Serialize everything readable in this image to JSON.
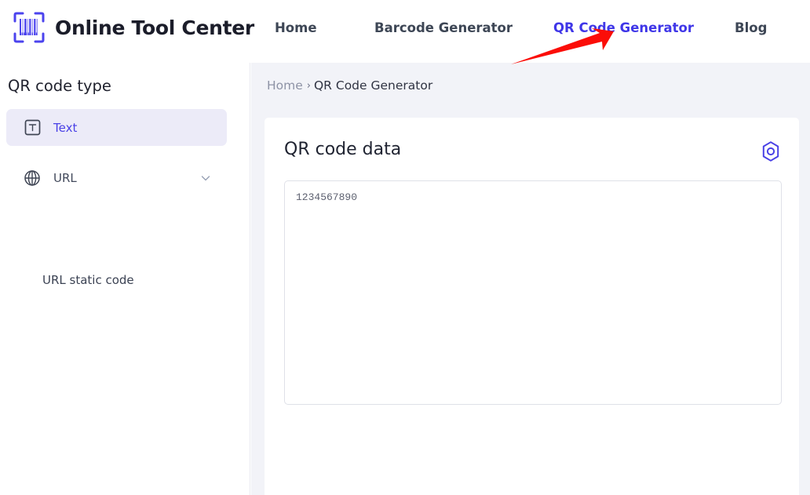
{
  "brand": {
    "name": "Online Tool Center",
    "logo_icon": "barcode-scanner-icon"
  },
  "nav": {
    "items": [
      {
        "label": "Home",
        "active": false
      },
      {
        "label": "Barcode Generator",
        "active": false
      },
      {
        "label": "QR Code Generator",
        "active": true
      },
      {
        "label": "Blog",
        "active": false
      }
    ],
    "active_color": "#3f36e8",
    "inactive_color": "#3d4655"
  },
  "annotation": {
    "type": "arrow",
    "color": "#fb0d08",
    "points_to": "QR Code Generator"
  },
  "sidebar": {
    "title": "QR code type",
    "items": [
      {
        "label": "Text",
        "icon": "text-box-icon",
        "selected": true,
        "expandable": false
      },
      {
        "label": "URL",
        "icon": "globe-icon",
        "selected": false,
        "expandable": true,
        "chevron": "chevron-down-icon"
      }
    ],
    "sub_items": [
      {
        "label": "URL static code"
      }
    ],
    "selected_bg": "#ecebf8",
    "selected_color": "#4a41e6"
  },
  "breadcrumb": {
    "home": "Home",
    "separator": "›",
    "current": "QR Code Generator"
  },
  "card": {
    "title": "QR code data",
    "action_icon": "hexagon-target-icon",
    "action_color": "#4a41e6",
    "textarea": {
      "value": "1234567890",
      "placeholder": ""
    }
  }
}
